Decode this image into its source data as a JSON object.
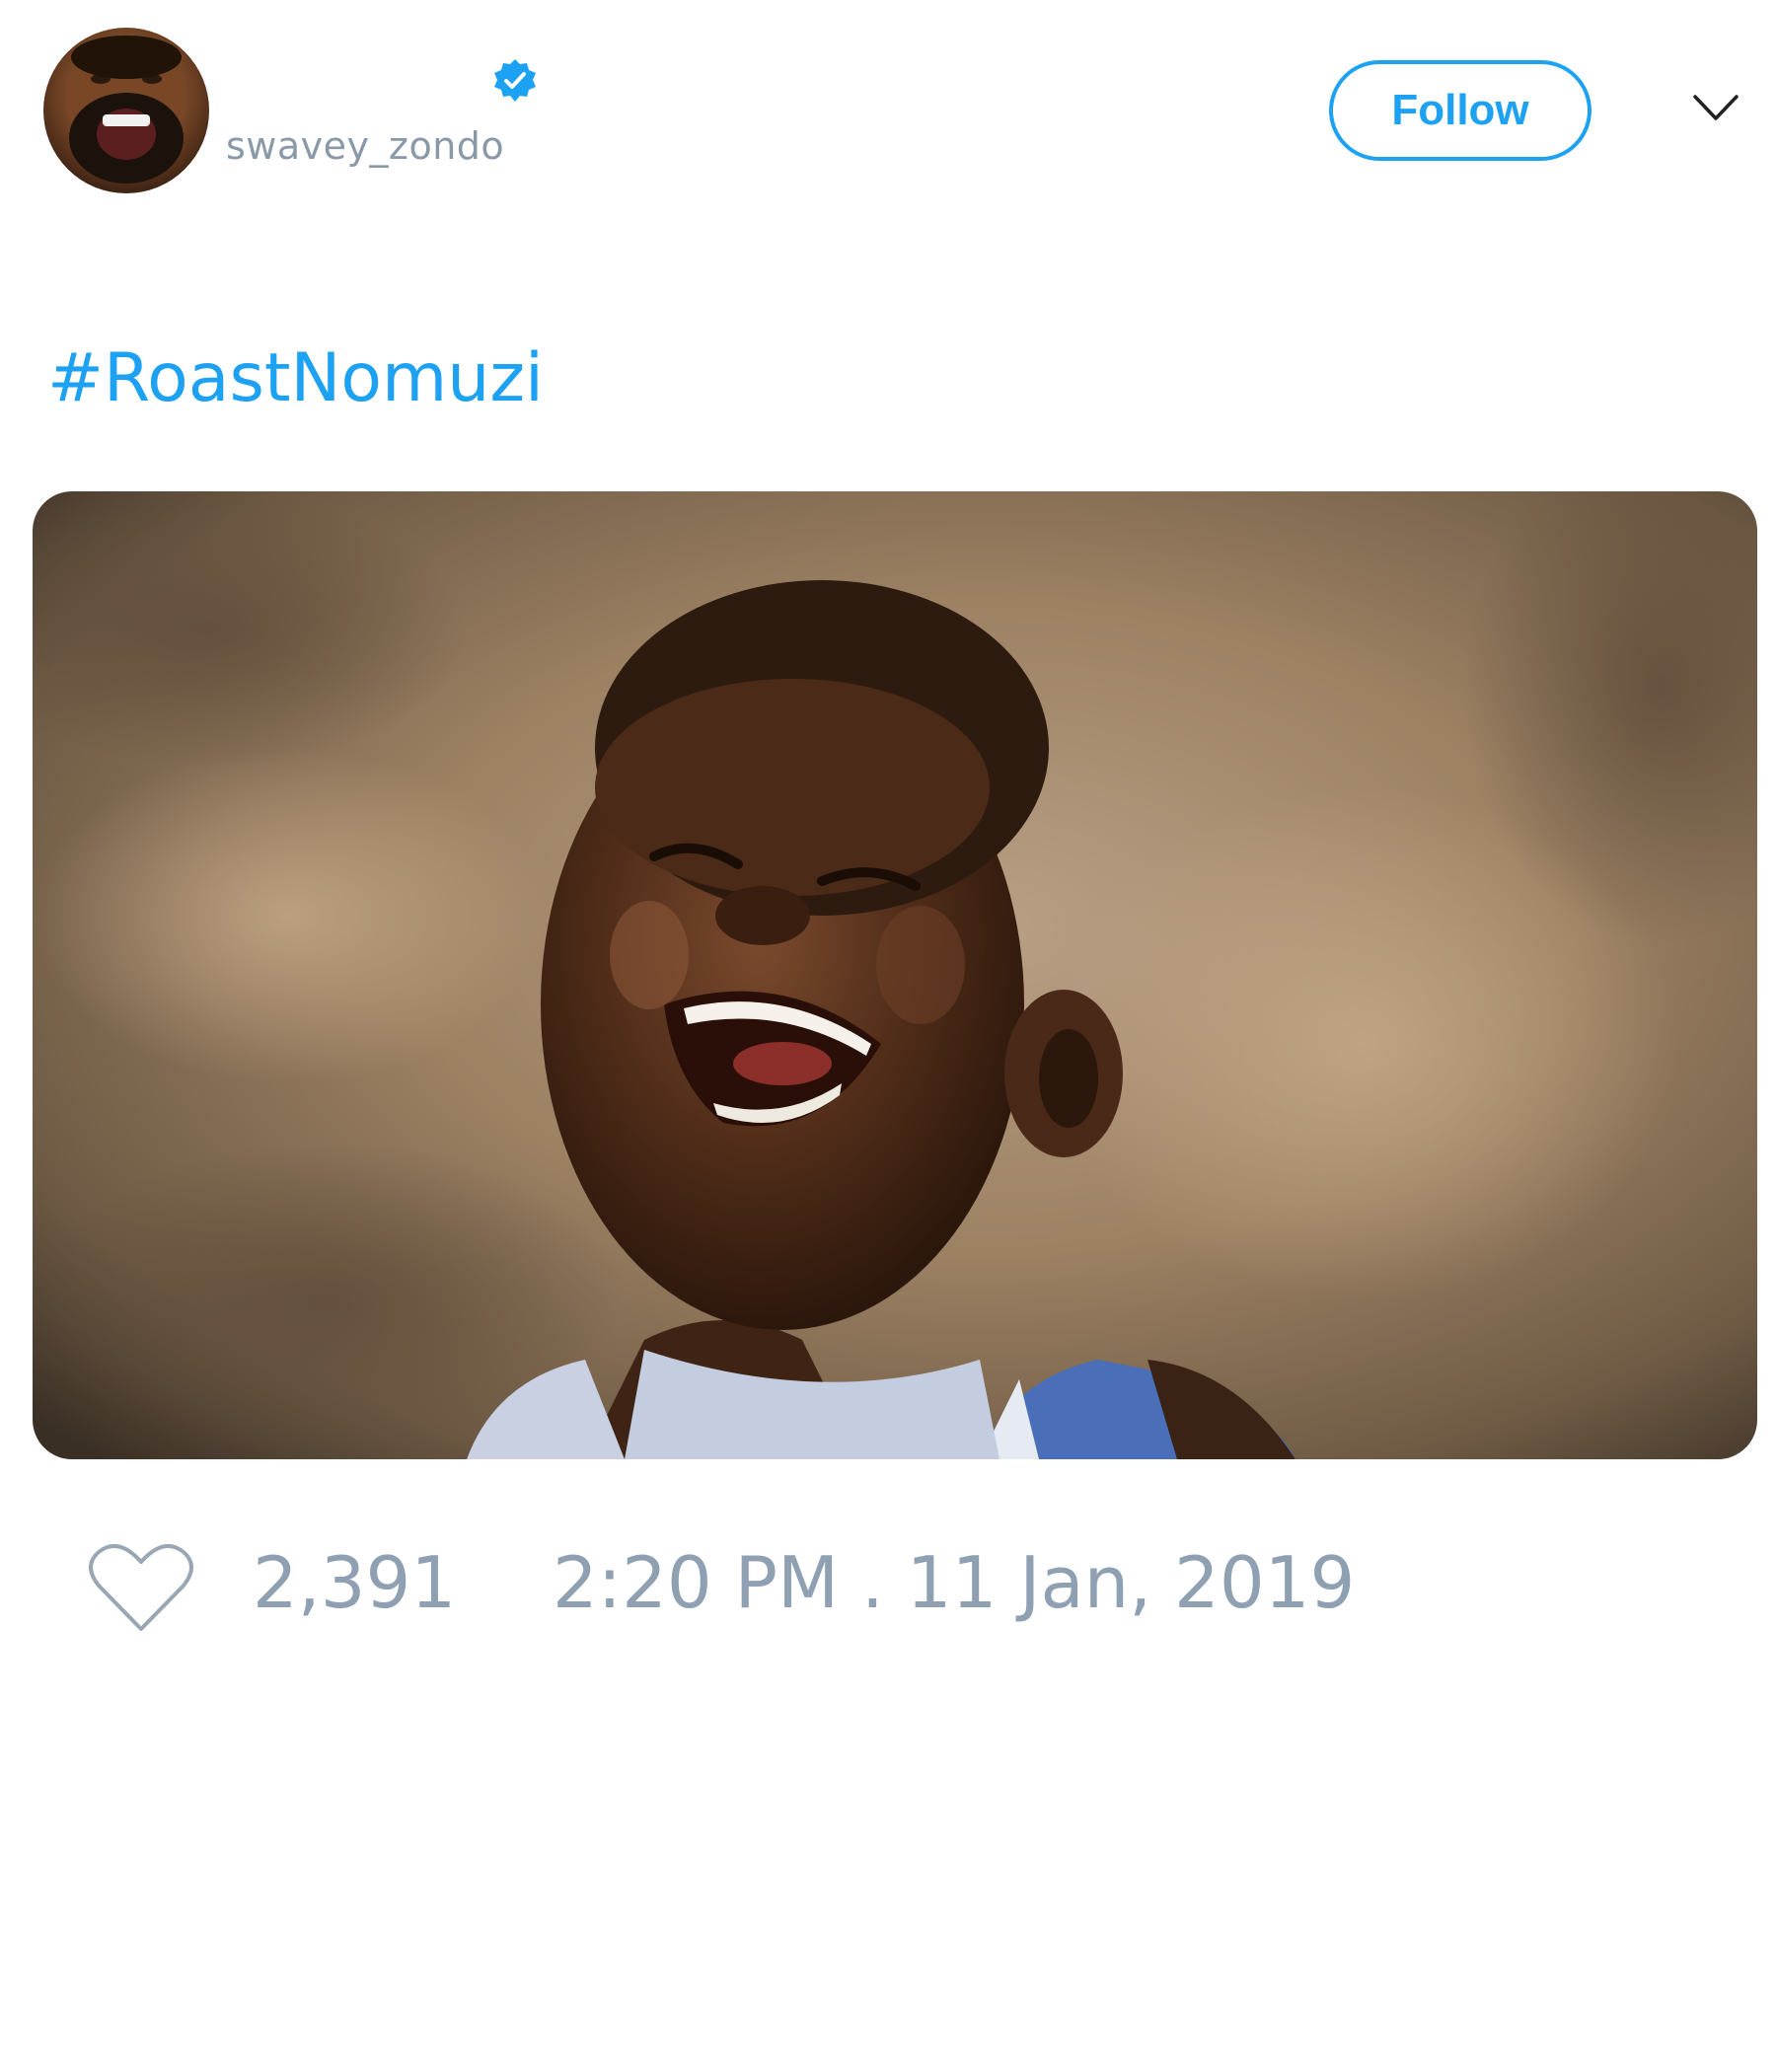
{
  "header": {
    "handle": "swavey_zondo",
    "verified_icon": "verified-badge-icon",
    "follow_label": "Follow",
    "menu_icon": "chevron-down-icon"
  },
  "tweet": {
    "text": "#RoastNomuzi",
    "media_icon": "photo-laughing-boy"
  },
  "footer": {
    "like_icon": "heart-icon",
    "like_count": "2,391",
    "timestamp": "2:20 PM . 11 Jan, 2019"
  },
  "colors": {
    "accent": "#1da1f2",
    "muted_text": "#8fa0b3",
    "handle_text": "#8a99a8",
    "background": "#ffffff"
  }
}
